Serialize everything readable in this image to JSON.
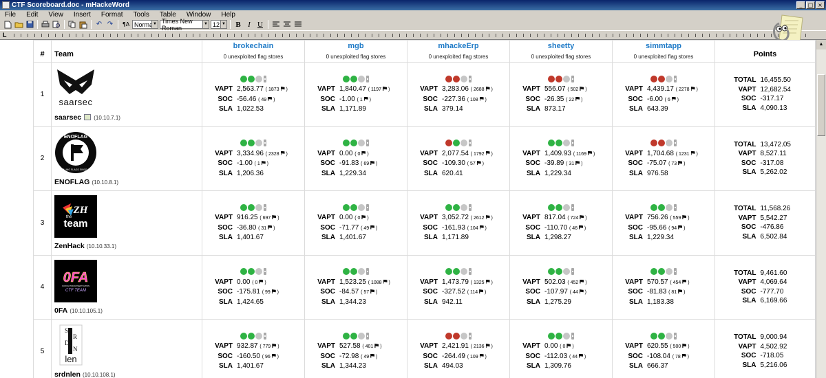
{
  "window": {
    "title": "CTF Scoreboard.doc - mHackeWord",
    "min": "_",
    "max": "□",
    "close": "×"
  },
  "menu": [
    "File",
    "Edit",
    "View",
    "Insert",
    "Format",
    "Tools",
    "Table",
    "Window",
    "Help"
  ],
  "toolbar": {
    "style": "Normal",
    "font": "Times New Roman",
    "size": "12",
    "bold": "B",
    "italic": "I",
    "underline": "U"
  },
  "table": {
    "headers": {
      "num": "#",
      "team": "Team",
      "points": "Points"
    },
    "services": [
      {
        "name": "brokechain",
        "sub": "0 unexploited flag stores"
      },
      {
        "name": "mgb",
        "sub": "0 unexploited flag stores"
      },
      {
        "name": "mhackeErp",
        "sub": "0 unexploited flag stores"
      },
      {
        "name": "sheetty",
        "sub": "0 unexploited flag stores"
      },
      {
        "name": "simmtapp",
        "sub": "0 unexploited flag stores"
      }
    ],
    "labels": {
      "vapt": "VAPT",
      "soc": "SOC",
      "sla": "SLA",
      "total": "TOTAL"
    },
    "rows": [
      {
        "num": "1",
        "name": "saarsec",
        "ip": "(10.10.7.1)",
        "cells": [
          {
            "dots": [
              "green",
              "green",
              "grey"
            ],
            "vapt": "2,563.77",
            "vf": "( 1873 ",
            "soc": "-56.46",
            "sf": "( 49 ",
            "sla": "1,022.53"
          },
          {
            "dots": [
              "green",
              "green",
              "grey"
            ],
            "vapt": "1,840.47",
            "vf": "( 1197 ",
            "soc": "-1.00",
            "sf": "( 1 ",
            "sla": "1,171.89"
          },
          {
            "dots": [
              "red",
              "red",
              "grey"
            ],
            "vapt": "3,283.06",
            "vf": "( 2688 ",
            "soc": "-227.36",
            "sf": "( 108 ",
            "sla": "379.14"
          },
          {
            "dots": [
              "red",
              "red",
              "grey"
            ],
            "vapt": "556.07",
            "vf": "( 502 ",
            "soc": "-26.35",
            "sf": "( 22 ",
            "sla": "873.17"
          },
          {
            "dots": [
              "red",
              "red",
              "grey"
            ],
            "vapt": "4,439.17",
            "vf": "( 2278 ",
            "soc": "-6.00",
            "sf": "( 6 ",
            "sla": "643.39"
          }
        ],
        "points": {
          "total": "16,455.50",
          "vapt": "12,682.54",
          "soc": "-317.17",
          "sla": "4,090.13"
        }
      },
      {
        "num": "2",
        "name": "ENOFLAG",
        "ip": "(10.10.8.1)",
        "cells": [
          {
            "dots": [
              "green",
              "green",
              "grey"
            ],
            "vapt": "3,334.96",
            "vf": "( 2328 ",
            "soc": "-1.00",
            "sf": "( 1 ",
            "sla": "1,206.36"
          },
          {
            "dots": [
              "green",
              "green",
              "grey"
            ],
            "vapt": "0.00",
            "vf": "( 0 ",
            "soc": "-91.83",
            "sf": "( 69 ",
            "sla": "1,229.34"
          },
          {
            "dots": [
              "red",
              "green",
              "grey"
            ],
            "vapt": "2,077.54",
            "vf": "( 1792 ",
            "soc": "-109.30",
            "sf": "( 57 ",
            "sla": "620.41"
          },
          {
            "dots": [
              "green",
              "green",
              "grey"
            ],
            "vapt": "1,409.93",
            "vf": "( 1169 ",
            "soc": "-39.89",
            "sf": "( 31 ",
            "sla": "1,229.34"
          },
          {
            "dots": [
              "red",
              "red",
              "grey"
            ],
            "vapt": "1,704.68",
            "vf": "( 1231 ",
            "soc": "-75.07",
            "sf": "( 73 ",
            "sla": "976.58"
          }
        ],
        "points": {
          "total": "13,472.05",
          "vapt": "8,527.11",
          "soc": "-317.08",
          "sla": "5,262.02"
        }
      },
      {
        "num": "3",
        "name": "ZenHack",
        "ip": "(10.10.33.1)",
        "cells": [
          {
            "dots": [
              "green",
              "green",
              "grey"
            ],
            "vapt": "916.25",
            "vf": "( 697 ",
            "soc": "-36.80",
            "sf": "( 31 ",
            "sla": "1,401.67"
          },
          {
            "dots": [
              "green",
              "green",
              "grey"
            ],
            "vapt": "0.00",
            "vf": "( 0 ",
            "soc": "-71.77",
            "sf": "( 49 ",
            "sla": "1,401.67"
          },
          {
            "dots": [
              "green",
              "green",
              "grey"
            ],
            "vapt": "3,052.72",
            "vf": "( 2612 ",
            "soc": "-161.93",
            "sf": "( 104 ",
            "sla": "1,171.89"
          },
          {
            "dots": [
              "green",
              "green",
              "grey"
            ],
            "vapt": "817.04",
            "vf": "( 724 ",
            "soc": "-110.70",
            "sf": "( 46 ",
            "sla": "1,298.27"
          },
          {
            "dots": [
              "green",
              "green",
              "grey"
            ],
            "vapt": "756.26",
            "vf": "( 559 ",
            "soc": "-95.66",
            "sf": "( 94 ",
            "sla": "1,229.34"
          }
        ],
        "points": {
          "total": "11,568.26",
          "vapt": "5,542.27",
          "soc": "-476.86",
          "sla": "6,502.84"
        }
      },
      {
        "num": "4",
        "name": "0FA",
        "ip": "(10.10.105.1)",
        "cells": [
          {
            "dots": [
              "green",
              "green",
              "grey"
            ],
            "vapt": "0.00",
            "vf": "( 0 ",
            "soc": "-175.81",
            "sf": "( 99 ",
            "sla": "1,424.65"
          },
          {
            "dots": [
              "green",
              "green",
              "grey"
            ],
            "vapt": "1,523.25",
            "vf": "( 1088 ",
            "soc": "-84.57",
            "sf": "( 57 ",
            "sla": "1,344.23"
          },
          {
            "dots": [
              "green",
              "green",
              "grey"
            ],
            "vapt": "1,473.79",
            "vf": "( 1325 ",
            "soc": "-327.52",
            "sf": "( 114 ",
            "sla": "942.11"
          },
          {
            "dots": [
              "green",
              "green",
              "grey"
            ],
            "vapt": "502.03",
            "vf": "( 452 ",
            "soc": "-107.97",
            "sf": "( 44 ",
            "sla": "1,275.29"
          },
          {
            "dots": [
              "green",
              "green",
              "grey"
            ],
            "vapt": "570.57",
            "vf": "( 454 ",
            "soc": "-81.83",
            "sf": "( 81 ",
            "sla": "1,183.38"
          }
        ],
        "points": {
          "total": "9,461.60",
          "vapt": "4,069.64",
          "soc": "-777.70",
          "sla": "6,169.66"
        }
      },
      {
        "num": "5",
        "name": "srdnlen",
        "ip": "(10.10.108.1)",
        "cells": [
          {
            "dots": [
              "green",
              "green",
              "grey"
            ],
            "vapt": "932.87",
            "vf": "( 779 ",
            "soc": "-160.50",
            "sf": "( 96 ",
            "sla": "1,401.67"
          },
          {
            "dots": [
              "green",
              "green",
              "grey"
            ],
            "vapt": "527.58",
            "vf": "( 401 ",
            "soc": "-72.98",
            "sf": "( 49 ",
            "sla": "1,344.23"
          },
          {
            "dots": [
              "red",
              "red",
              "grey"
            ],
            "vapt": "2,421.91",
            "vf": "( 2136 ",
            "soc": "-264.49",
            "sf": "( 109 ",
            "sla": "494.03"
          },
          {
            "dots": [
              "green",
              "green",
              "grey"
            ],
            "vapt": "0.00",
            "vf": "( 0 ",
            "soc": "-112.03",
            "sf": "( 44 ",
            "sla": "1,309.76"
          },
          {
            "dots": [
              "green",
              "green",
              "grey"
            ],
            "vapt": "620.55",
            "vf": "( 500 ",
            "soc": "-108.04",
            "sf": "( 78 ",
            "sla": "666.37"
          }
        ],
        "points": {
          "total": "9,000.94",
          "vapt": "4,502.92",
          "soc": "-718.05",
          "sla": "5,216.06"
        }
      }
    ]
  },
  "logos": {
    "saarsec": "saarsec",
    "enoflag_top": "ENOFLAG",
    "enoflag_bottom": "STEALING FLAGS SINCE 2018",
    "zh_top": "ZH",
    "zh_the": "the",
    "zh_team": "team",
    "ofa_big": "0FA",
    "ofa_tiny": "OUR FACTOR AUTHENTICATION",
    "ofa_sub": "CTF TEAM",
    "srd_vertical": [
      "S",
      "R",
      "D",
      "N"
    ],
    "srd_bottom": "len"
  }
}
